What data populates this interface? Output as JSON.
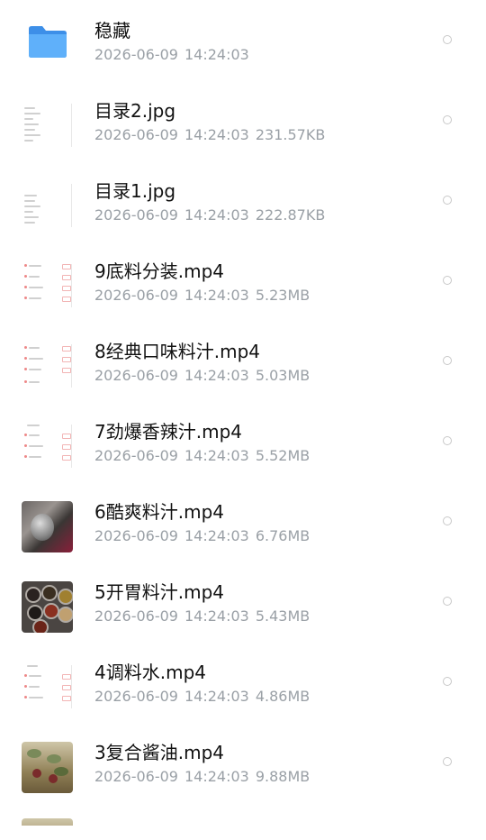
{
  "files": [
    {
      "name": "稳藏",
      "date": "2026-06-09",
      "time": "14:24:03",
      "size": "",
      "thumb": "folder-icon"
    },
    {
      "name": "目录2.jpg",
      "date": "2026-06-09",
      "time": "14:24:03",
      "size": "231.57KB",
      "thumb": "document-thumbnail"
    },
    {
      "name": "目录1.jpg",
      "date": "2026-06-09",
      "time": "14:24:03",
      "size": "222.87KB",
      "thumb": "document-thumbnail"
    },
    {
      "name": "9底料分装.mp4",
      "date": "2026-06-09",
      "time": "14:24:03",
      "size": "5.23MB",
      "thumb": "document-thumbnail"
    },
    {
      "name": "8经典口味料汁.mp4",
      "date": "2026-06-09",
      "time": "14:24:03",
      "size": "5.03MB",
      "thumb": "document-thumbnail"
    },
    {
      "name": "7劲爆香辣汁.mp4",
      "date": "2026-06-09",
      "time": "14:24:03",
      "size": "5.52MB",
      "thumb": "document-thumbnail"
    },
    {
      "name": "6酷爽料汁.mp4",
      "date": "2026-06-09",
      "time": "14:24:03",
      "size": "6.76MB",
      "thumb": "video-thumbnail"
    },
    {
      "name": "5开胃料汁.mp4",
      "date": "2026-06-09",
      "time": "14:24:03",
      "size": "5.43MB",
      "thumb": "video-thumbnail"
    },
    {
      "name": "4调料水.mp4",
      "date": "2026-06-09",
      "time": "14:24:03",
      "size": "4.86MB",
      "thumb": "document-thumbnail"
    },
    {
      "name": "3复合酱油.mp4",
      "date": "2026-06-09",
      "time": "14:24:03",
      "size": "9.88MB",
      "thumb": "video-thumbnail"
    }
  ],
  "colors": {
    "folder": "#4aa3f5",
    "name_text": "#111111",
    "meta_text": "#9aa0a6"
  }
}
